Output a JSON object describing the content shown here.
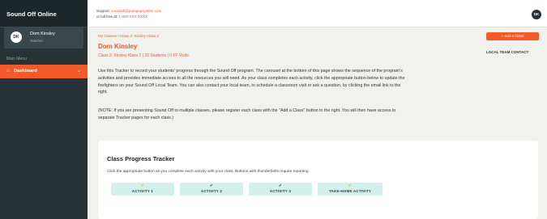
{
  "sidebar": {
    "brand": "Sound Off Online",
    "user": {
      "initials": "DK",
      "name": "Dom Kinsley",
      "role": "Teacher"
    },
    "menu_heading": "Main Menu",
    "items": [
      {
        "label": "Dashboard",
        "icon": "home-icon"
      }
    ]
  },
  "topbar": {
    "support_label": "Support:",
    "support_email": "soundoff@pumpupsystem.com",
    "tollfree_label": "or toll free at:",
    "tollfree_number": "1-800-XXX-XXXX",
    "avatar_initials": "DK"
  },
  "main": {
    "breadcrumb": "My Classes / Class 2: Kinsley Klass 2",
    "title": "Dom Kinsley",
    "class_meta": "Class 2: Kinsley Klass 2  |  20 Students  |  0 FF Visits",
    "add_class_label": "+ Add a Class",
    "local_team_label": "LOCAL TEAM CONTACT",
    "intro": "Use this Tracker to record your students' progress through the Sound Off program. The carousel at the bottom of this page shows the sequence of the program's activities and provides immediate access to all the resources you will need. As your class completes each activity, click the appropriate button below to update the firefighters on your Sound Off Local Team. You can also contact your local team, to schedule a classroom visit or ask a question, by clicking the email link to the right.",
    "note": "(NOTE: If you are presenting Sound Off to multiple classes, please register each class with the \"Add a Class\" button to the right. You will then have access to separate Tracker pages for each class.)"
  },
  "tracker": {
    "title": "Class Progress Tracker",
    "subtitle": "Click the appropriate button as you complete each activity with your class. Buttons with thunderbolts require reporting.",
    "activities": [
      {
        "label": "ACTIVITY 1",
        "icon": "⚡"
      },
      {
        "label": "ACTIVITY 2",
        "icon": "✔"
      },
      {
        "label": "ACTIVITY 3",
        "icon": "✔"
      },
      {
        "label": "TAKE-HOME ACTIVITY",
        "icon": "⚡"
      }
    ]
  },
  "colors": {
    "accent": "#f15b2a",
    "sidebar": "#263236",
    "activity_bg": "#d4f0ec"
  }
}
